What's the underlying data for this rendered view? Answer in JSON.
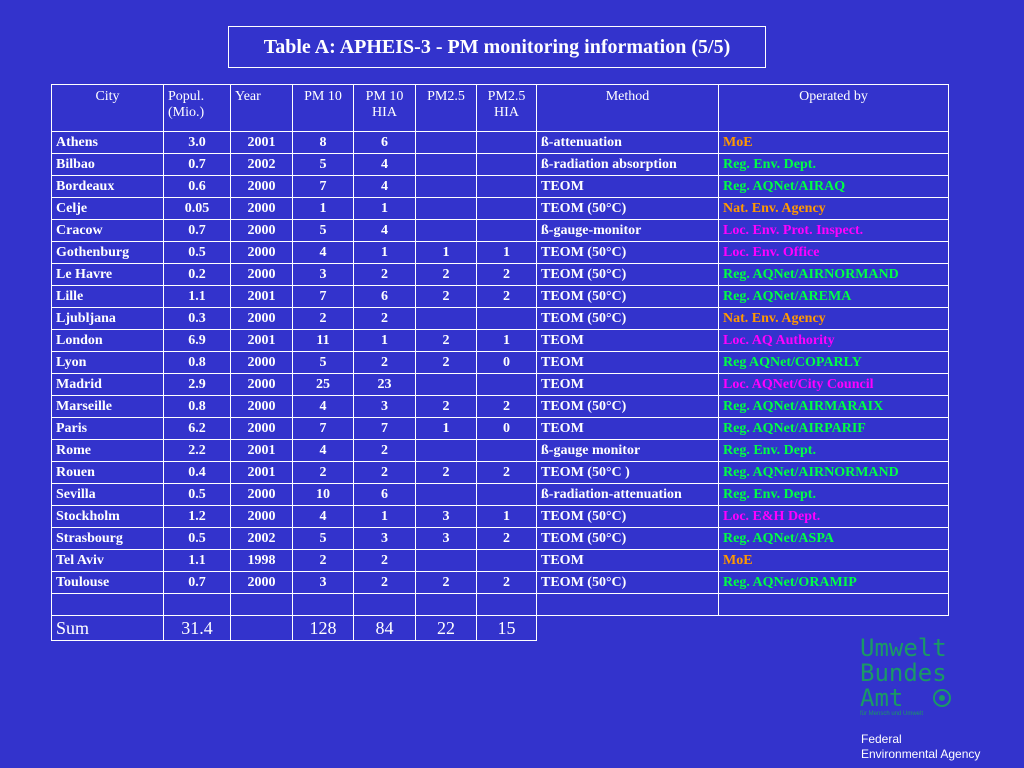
{
  "title": "Table A: APHEIS-3 - PM monitoring information  (5/5)",
  "colors": {
    "background": "#3333cc",
    "moe": "#ff9900",
    "green": "#00ff44",
    "magenta": "#ff00ff",
    "logo": "#1a9966"
  },
  "headers": {
    "city": "City",
    "popul": "Popul.",
    "popul2": "(Mio.)",
    "year": "Year",
    "pm10": "PM 10",
    "pm10hia": "PM 10",
    "pm10hia2": "HIA",
    "pm25": "PM2.5",
    "pm25hia": "PM2.5",
    "pm25hia2": "HIA",
    "method": "Method",
    "operated": "Operated by"
  },
  "rows": [
    {
      "city": "Athens",
      "pop": "3.0",
      "year": "2001",
      "pm10": "8",
      "pm10hia": "6",
      "pm25": "",
      "pm25hia": "",
      "method": "ß-attenuation",
      "op": "MoE",
      "opc": "moe"
    },
    {
      "city": "Bilbao",
      "pop": "0.7",
      "year": "2002",
      "pm10": "5",
      "pm10hia": "4",
      "pm25": "",
      "pm25hia": "",
      "method": "ß-radiation absorption",
      "op": "Reg. Env. Dept.",
      "opc": "green"
    },
    {
      "city": "Bordeaux",
      "pop": "0.6",
      "year": "2000",
      "pm10": "7",
      "pm10hia": "4",
      "pm25": "",
      "pm25hia": "",
      "method": "TEOM",
      "op": "Reg. AQNet/AIRAQ",
      "opc": "green"
    },
    {
      "city": "Celje",
      "pop": "0.05",
      "year": "2000",
      "pm10": "1",
      "pm10hia": "1",
      "pm25": "",
      "pm25hia": "",
      "method": "TEOM (50°C)",
      "op": "Nat. Env. Agency",
      "opc": "moe"
    },
    {
      "city": "Cracow",
      "pop": "0.7",
      "year": "2000",
      "pm10": "5",
      "pm10hia": "4",
      "pm25": "",
      "pm25hia": "",
      "method": "ß-gauge-monitor",
      "op": "Loc. Env. Prot. Inspect.",
      "opc": "magenta"
    },
    {
      "city": "Gothenburg",
      "pop": "0.5",
      "year": "2000",
      "pm10": "4",
      "pm10hia": "1",
      "pm25": "1",
      "pm25hia": "1",
      "method": "TEOM (50°C)",
      "op": "Loc. Env. Office",
      "opc": "magenta"
    },
    {
      "city": "Le Havre",
      "pop": "0.2",
      "year": "2000",
      "pm10": "3",
      "pm10hia": "2",
      "pm25": "2",
      "pm25hia": "2",
      "method": "TEOM (50°C)",
      "op": "Reg. AQNet/AIRNORMAND",
      "opc": "green"
    },
    {
      "city": "Lille",
      "pop": "1.1",
      "year": "2001",
      "pm10": "7",
      "pm10hia": "6",
      "pm25": "2",
      "pm25hia": "2",
      "method": "TEOM (50°C)",
      "op": "Reg. AQNet/AREMA",
      "opc": "green"
    },
    {
      "city": "Ljubljana",
      "pop": "0.3",
      "year": "2000",
      "pm10": "2",
      "pm10hia": "2",
      "pm25": "",
      "pm25hia": "",
      "method": "TEOM (50°C)",
      "op": "Nat. Env. Agency",
      "opc": "moe"
    },
    {
      "city": "London",
      "pop": "6.9",
      "year": "2001",
      "pm10": "11",
      "pm10hia": "1",
      "pm25": "2",
      "pm25hia": "1",
      "method": "TEOM",
      "op": "Loc. AQ Authority",
      "opc": "magenta"
    },
    {
      "city": "Lyon",
      "pop": "0.8",
      "year": "2000",
      "pm10": "5",
      "pm10hia": "2",
      "pm25": "2",
      "pm25hia": "0",
      "method": "TEOM",
      "op": "Reg AQNet/COPARLY",
      "opc": "green"
    },
    {
      "city": "Madrid",
      "pop": "2.9",
      "year": "2000",
      "pm10": "25",
      "pm10hia": "23",
      "pm25": "",
      "pm25hia": "",
      "method": "TEOM",
      "op": "Loc. AQNet/City Council",
      "opc": "magenta"
    },
    {
      "city": "Marseille",
      "pop": "0.8",
      "year": "2000",
      "pm10": "4",
      "pm10hia": "3",
      "pm25": "2",
      "pm25hia": "2",
      "method": "TEOM (50°C)",
      "op": "Reg. AQNet/AIRMARAIX",
      "opc": "green"
    },
    {
      "city": "Paris",
      "pop": "6.2",
      "year": "2000",
      "pm10": "7",
      "pm10hia": "7",
      "pm25": "1",
      "pm25hia": "0",
      "method": "TEOM",
      "op": "Reg. AQNet/AIRPARIF",
      "opc": "green"
    },
    {
      "city": "Rome",
      "pop": "2.2",
      "year": "2001",
      "pm10": "4",
      "pm10hia": "2",
      "pm25": "",
      "pm25hia": "",
      "method": "ß-gauge monitor",
      "op": "Reg. Env. Dept.",
      "opc": "green"
    },
    {
      "city": "Rouen",
      "pop": "0.4",
      "year": "2001",
      "pm10": "2",
      "pm10hia": "2",
      "pm25": "2",
      "pm25hia": "2",
      "method": "TEOM (50°C )",
      "op": "Reg. AQNet/AIRNORMAND",
      "opc": "green"
    },
    {
      "city": "Sevilla",
      "pop": "0.5",
      "year": "2000",
      "pm10": "10",
      "pm10hia": "6",
      "pm25": "",
      "pm25hia": "",
      "method": "ß-radiation-attenuation",
      "op": "Reg. Env. Dept.",
      "opc": "green"
    },
    {
      "city": "Stockholm",
      "pop": "1.2",
      "year": "2000",
      "pm10": "4",
      "pm10hia": "1",
      "pm25": "3",
      "pm25hia": "1",
      "method": "TEOM (50°C)",
      "op": "Loc. E&H Dept.",
      "opc": "magenta"
    },
    {
      "city": "Strasbourg",
      "pop": "0.5",
      "year": "2002",
      "pm10": "5",
      "pm10hia": "3",
      "pm25": "3",
      "pm25hia": "2",
      "method": "TEOM (50°C)",
      "op": "Reg. AQNet/ASPA",
      "opc": "green"
    },
    {
      "city": "Tel Aviv",
      "pop": "1.1",
      "year": "1998",
      "pm10": "2",
      "pm10hia": "2",
      "pm25": "",
      "pm25hia": "",
      "method": "TEOM",
      "op": "MoE",
      "opc": "moe"
    },
    {
      "city": "Toulouse",
      "pop": "0.7",
      "year": "2000",
      "pm10": "3",
      "pm10hia": "2",
      "pm25": "2",
      "pm25hia": "2",
      "method": "TEOM (50°C)",
      "op": "Reg. AQNet/ORAMIP",
      "opc": "green"
    }
  ],
  "sum": {
    "label": "Sum",
    "pop": "31.4",
    "pm10": "128",
    "pm10hia": "84",
    "pm25": "22",
    "pm25hia": "15"
  },
  "logo": {
    "line1": "Umwelt",
    "line2": "Bundes",
    "line3": "Amt",
    "tagline": "für Mensch und Umwelt"
  },
  "agency": {
    "line1": "Federal",
    "line2": "Environmental Agency"
  }
}
